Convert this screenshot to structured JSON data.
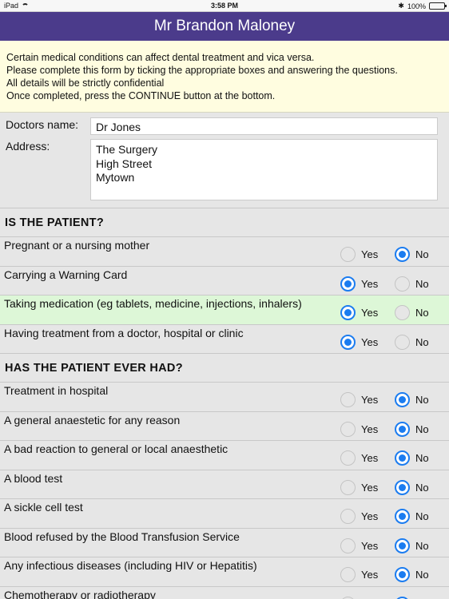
{
  "status": {
    "device": "iPad",
    "time": "3:58 PM",
    "battery": "100%"
  },
  "header": {
    "title": "Mr Brandon Maloney"
  },
  "intro": {
    "lines": [
      "Certain medical conditions can affect dental treatment and vica versa.",
      "Please complete this form by ticking the appropriate boxes and answering the questions.",
      "All details will be strictly confidential",
      "Once completed, press the CONTINUE button at the bottom."
    ]
  },
  "doctor": {
    "name_label": "Doctors name:",
    "name_value": "Dr Jones",
    "address_label": "Address:",
    "address_lines": [
      "The Surgery",
      "High Street",
      "Mytown"
    ]
  },
  "radio_labels": {
    "yes": "Yes",
    "no": "No"
  },
  "sections": [
    {
      "title": "IS THE PATIENT?",
      "questions": [
        {
          "text": "Pregnant or a nursing mother",
          "answer": "no"
        },
        {
          "text": "Carrying a Warning Card",
          "answer": "yes"
        },
        {
          "text": "Taking medication (eg tablets, medicine, injections, inhalers)",
          "answer": "yes",
          "highlight": true
        },
        {
          "text": "Having treatment from a doctor, hospital or clinic",
          "answer": "yes"
        }
      ]
    },
    {
      "title": "HAS THE PATIENT EVER HAD?",
      "questions": [
        {
          "text": "Treatment in hospital",
          "answer": "no"
        },
        {
          "text": "A general anaestetic for any reason",
          "answer": "no"
        },
        {
          "text": "A bad reaction to general or local anaesthetic",
          "answer": "no"
        },
        {
          "text": "A blood test",
          "answer": "no"
        },
        {
          "text": "A sickle cell test",
          "answer": "no"
        },
        {
          "text": "Blood refused by the Blood Transfusion Service",
          "answer": "no"
        },
        {
          "text": "Any infectious diseases (including HIV or Hepatitis)",
          "answer": "no"
        },
        {
          "text": "Chemotherapy or radiotherapy",
          "answer": "no"
        }
      ]
    }
  ],
  "colors": {
    "title_bar": "#4b3b8b",
    "intro_bg": "#fffde0",
    "highlight_bg": "#ddf7d7",
    "radio_on": "#1b7cf0"
  }
}
